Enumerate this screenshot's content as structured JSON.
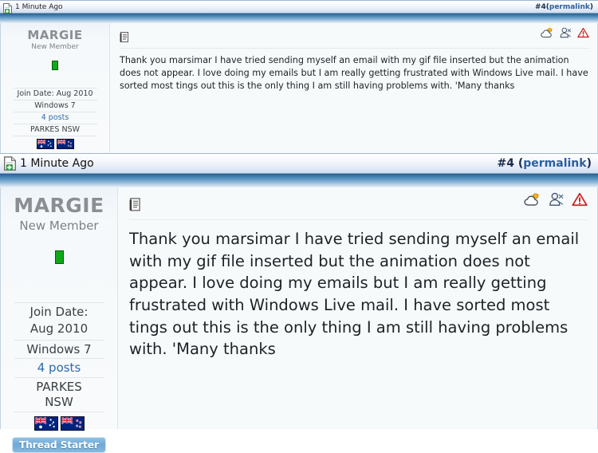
{
  "posts": [
    {
      "id": "post-normal",
      "bar": {
        "timestamp": "1 Minute Ago",
        "post_number": "#4",
        "open_paren": "(",
        "permalink_label": "permalink",
        "close_paren": ")",
        "new_post_icon": "new-post-document-icon"
      },
      "user": {
        "name": "MARGIE",
        "title": "New Member",
        "online_status": "online-indicator",
        "join_date": "Join Date: Aug 2010",
        "os": "Windows 7",
        "post_count": "4 posts",
        "location": "PARKES NSW",
        "flags": [
          "australia-flag",
          "new-zealand-flag"
        ],
        "badge": "Thread Starter"
      },
      "message": {
        "post_icon": "post-text-document-icon",
        "actions": [
          "weather-cloud-icon",
          "user-profile-icon",
          "report-warning-icon"
        ],
        "body": "Thank you marsimar I have tried sending myself an email with my gif file inserted but the animation does not appear. I love doing my emails but I am really getting frustrated with Windows Live mail. I have sorted most tings out this is the only thing I am still having problems with. 'Many thanks"
      }
    },
    {
      "id": "post-zoomed",
      "bar": {
        "timestamp": "1 Minute Ago",
        "post_number": "#4",
        "open_paren": "(",
        "permalink_label": "permalink",
        "close_paren": ")",
        "new_post_icon": "new-post-document-icon"
      },
      "user": {
        "name": "MARGIE",
        "title": "New Member",
        "online_status": "online-indicator",
        "join_date": "Join Date:",
        "join_date_2": "Aug 2010",
        "os": "Windows 7",
        "post_count": "4 posts",
        "location": "PARKES",
        "location_2": "NSW",
        "flags": [
          "australia-flag",
          "new-zealand-flag"
        ],
        "badge": "Thread Starter"
      },
      "message": {
        "post_icon": "post-text-document-icon",
        "actions": [
          "weather-cloud-icon",
          "user-profile-icon",
          "report-warning-icon"
        ],
        "body": "Thank you marsimar I have tried sending myself an email with my gif file inserted but the animation does not appear. I love doing my emails but I am really getting frustrated with Windows Live mail. I have sorted most tings out this is the only thing I am still having problems with. 'Many thanks"
      }
    }
  ],
  "colors": {
    "permalink": "#2b5f9e",
    "link": "#2f6ba5",
    "header_blue": "#27628f",
    "status_green": "#0fa818",
    "badge_blue": "#6fa9d6",
    "warning_red": "#cc2222"
  }
}
